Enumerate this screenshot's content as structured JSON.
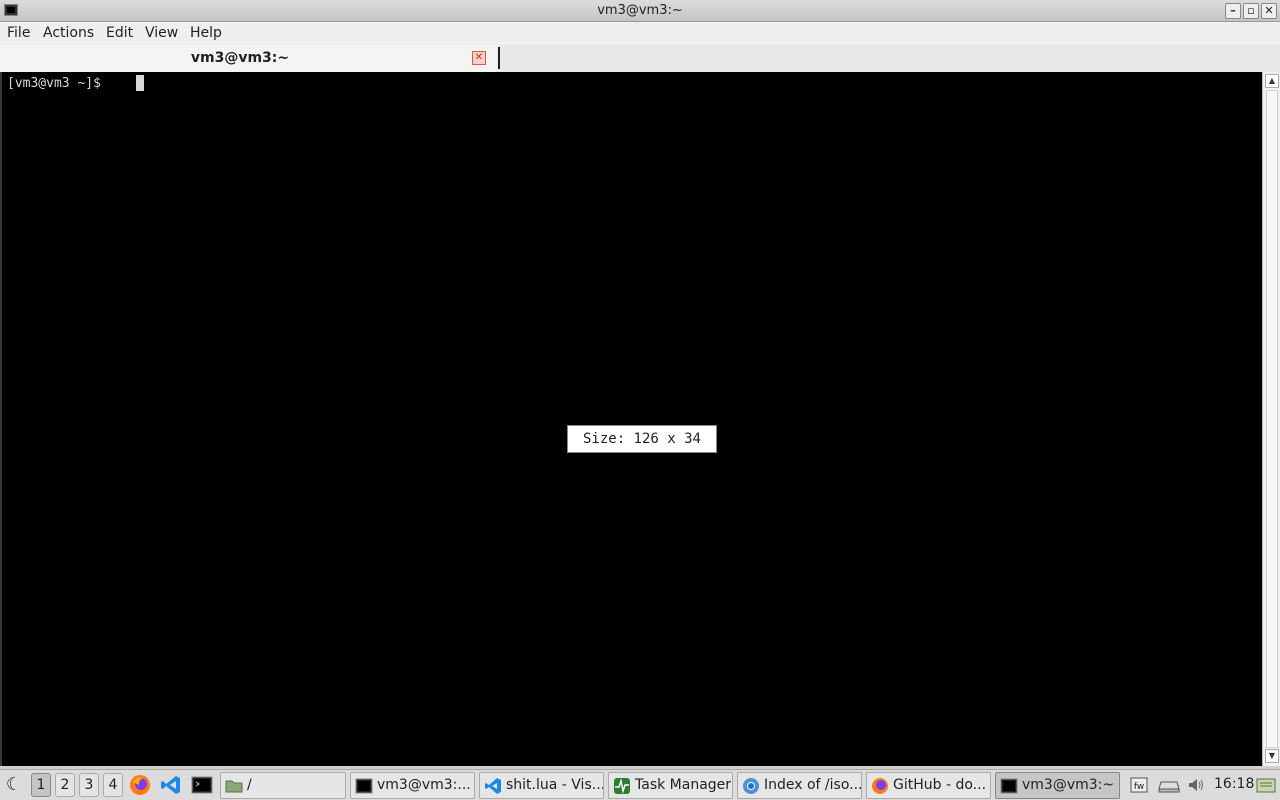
{
  "window": {
    "title": "vm3@vm3:~",
    "buttons": {
      "minimize": "–",
      "maximize": "▫",
      "close": "✕"
    }
  },
  "menubar": {
    "items": [
      "File",
      "Actions",
      "Edit",
      "View",
      "Help"
    ]
  },
  "tabs": [
    {
      "label": "vm3@vm3:~",
      "close": "✕"
    }
  ],
  "terminal": {
    "prompt": "[vm3@vm3 ~]$ ",
    "size_popup": "Size: 126 x 34",
    "bg_color": "#000000",
    "fg_color": "#d8d8d8"
  },
  "taskbar": {
    "workspaces": [
      "1",
      "2",
      "3",
      "4"
    ],
    "active_workspace": "1",
    "launchers": [
      "firefox-icon",
      "vscode-icon",
      "terminal-icon"
    ],
    "tasks": [
      {
        "label": "/",
        "icon": "folder-icon"
      },
      {
        "label": "vm3@vm3:...",
        "icon": "terminal-icon"
      },
      {
        "label": "shit.lua - Vis...",
        "icon": "vscode-icon"
      },
      {
        "label": "Task Manager",
        "icon": "task-manager-icon"
      },
      {
        "label": "Index of /iso...",
        "icon": "chromium-icon"
      },
      {
        "label": "GitHub - do...",
        "icon": "firefox-icon"
      },
      {
        "label": "vm3@vm3:~",
        "icon": "terminal-icon"
      }
    ],
    "active_task": "vm3@vm3:~",
    "tray": [
      "keyboard-layout-icon",
      "drive-icon",
      "volume-icon"
    ],
    "clock": "16:18",
    "tray_end": "notes-icon"
  }
}
